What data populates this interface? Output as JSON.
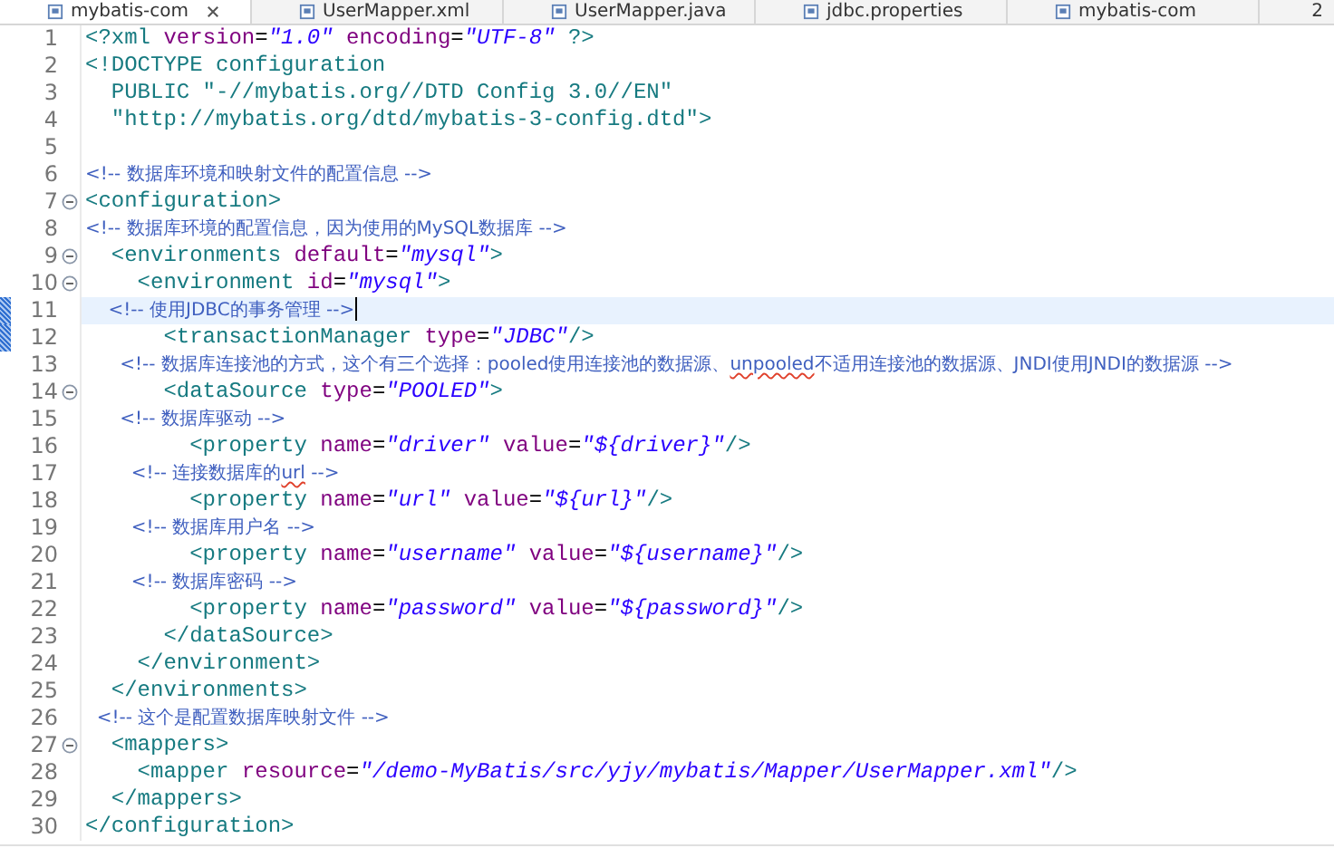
{
  "tabs": [
    {
      "label": "mybatis-com",
      "selected": true,
      "closable": true
    },
    {
      "label": "UserMapper.xml",
      "selected": false,
      "closable": false
    },
    {
      "label": "UserMapper.java",
      "selected": false,
      "closable": false
    },
    {
      "label": "jdbc.properties",
      "selected": false,
      "closable": false
    },
    {
      "label": "mybatis-com",
      "selected": false,
      "closable": false
    }
  ],
  "overflow_count": "2",
  "lines": [
    {
      "number": "1",
      "foldable": false,
      "current": false,
      "marked": false,
      "tokens": [
        {
          "kind": "tag",
          "text": "<?xml"
        },
        {
          "kind": "attr",
          "text": " version"
        },
        {
          "kind": "punct",
          "text": "="
        },
        {
          "kind": "value",
          "text": "\"1.0\""
        },
        {
          "kind": "attr",
          "text": " encoding"
        },
        {
          "kind": "punct",
          "text": "="
        },
        {
          "kind": "value",
          "text": "\"UTF-8\""
        },
        {
          "kind": "tag",
          "text": " ?>"
        }
      ]
    },
    {
      "number": "2",
      "foldable": false,
      "current": false,
      "marked": false,
      "tokens": [
        {
          "kind": "tag",
          "text": "<!DOCTYPE configuration"
        }
      ]
    },
    {
      "number": "3",
      "foldable": false,
      "current": false,
      "marked": false,
      "tokens": [
        {
          "kind": "tag",
          "text": "  PUBLIC \"-//mybatis.org//DTD Config 3.0//EN\""
        }
      ]
    },
    {
      "number": "4",
      "foldable": false,
      "current": false,
      "marked": false,
      "tokens": [
        {
          "kind": "tag",
          "text": "  \"http://mybatis.org/dtd/mybatis-3-config.dtd\">"
        }
      ]
    },
    {
      "number": "5",
      "foldable": false,
      "current": false,
      "marked": false
    },
    {
      "number": "6",
      "foldable": false,
      "current": false,
      "marked": false,
      "tokens": [
        {
          "kind": "comment",
          "text": "<!-- 数据库环境和映射文件的配置信息 -->"
        }
      ]
    },
    {
      "number": "7",
      "foldable": true,
      "current": false,
      "marked": false,
      "tokens": [
        {
          "kind": "tag",
          "text": "<configuration>"
        }
      ]
    },
    {
      "number": "8",
      "foldable": false,
      "current": false,
      "marked": false,
      "tokens": [
        {
          "kind": "comment",
          "text": "<!-- 数据库环境的配置信息，因为使用的MySQL数据库 -->"
        }
      ]
    },
    {
      "number": "9",
      "foldable": true,
      "current": false,
      "marked": false,
      "tokens": [
        {
          "kind": "tag",
          "text": "  <environments"
        },
        {
          "kind": "attr",
          "text": " default"
        },
        {
          "kind": "punct",
          "text": "="
        },
        {
          "kind": "value",
          "text": "\"mysql\""
        },
        {
          "kind": "tag",
          "text": ">"
        }
      ]
    },
    {
      "number": "10",
      "foldable": true,
      "current": false,
      "marked": false,
      "tokens": [
        {
          "kind": "tag",
          "text": "    <environment"
        },
        {
          "kind": "attr",
          "text": " id"
        },
        {
          "kind": "punct",
          "text": "="
        },
        {
          "kind": "value",
          "text": "\"mysql\""
        },
        {
          "kind": "tag",
          "text": ">"
        }
      ]
    },
    {
      "number": "11",
      "foldable": false,
      "current": true,
      "marked": true,
      "tokens": [
        {
          "kind": "comment",
          "text": "    <!-- 使用JDBC的事务管理 -->"
        }
      ]
    },
    {
      "number": "12",
      "foldable": false,
      "current": false,
      "marked": true,
      "tokens": [
        {
          "kind": "tag",
          "text": "      <transactionManager"
        },
        {
          "kind": "attr",
          "text": " type"
        },
        {
          "kind": "punct",
          "text": "="
        },
        {
          "kind": "value",
          "text": "\"JDBC\""
        },
        {
          "kind": "tag",
          "text": "/>"
        }
      ]
    },
    {
      "number": "13",
      "foldable": false,
      "current": false,
      "marked": false,
      "tokens": [
        {
          "kind": "comment",
          "text": "      <!-- 数据库连接池的方式，这个有三个选择：pooled使用连接池的数据源、"
        },
        {
          "kind": "misspelled",
          "text": "unpooled"
        },
        {
          "kind": "comment",
          "text": "不适用连接池的数据源、JNDI使用JNDI的数据源 -->"
        }
      ]
    },
    {
      "number": "14",
      "foldable": true,
      "current": false,
      "marked": false,
      "tokens": [
        {
          "kind": "tag",
          "text": "      <dataSource"
        },
        {
          "kind": "attr",
          "text": " type"
        },
        {
          "kind": "punct",
          "text": "="
        },
        {
          "kind": "value",
          "text": "\"POOLED\""
        },
        {
          "kind": "tag",
          "text": ">"
        }
      ]
    },
    {
      "number": "15",
      "foldable": false,
      "current": false,
      "marked": false,
      "tokens": [
        {
          "kind": "comment",
          "text": "      <!-- 数据库驱动 -->"
        }
      ]
    },
    {
      "number": "16",
      "foldable": false,
      "current": false,
      "marked": false,
      "tokens": [
        {
          "kind": "tag",
          "text": "        <property"
        },
        {
          "kind": "attr",
          "text": " name"
        },
        {
          "kind": "punct",
          "text": "="
        },
        {
          "kind": "value",
          "text": "\"driver\""
        },
        {
          "kind": "attr",
          "text": " value"
        },
        {
          "kind": "punct",
          "text": "="
        },
        {
          "kind": "value",
          "text": "\"${driver}\""
        },
        {
          "kind": "tag",
          "text": "/>"
        }
      ]
    },
    {
      "number": "17",
      "foldable": false,
      "current": false,
      "marked": false,
      "tokens": [
        {
          "kind": "comment",
          "text": "        <!-- 连接数据库的"
        },
        {
          "kind": "misspelled",
          "text": "url"
        },
        {
          "kind": "comment",
          "text": " -->"
        }
      ]
    },
    {
      "number": "18",
      "foldable": false,
      "current": false,
      "marked": false,
      "tokens": [
        {
          "kind": "tag",
          "text": "        <property"
        },
        {
          "kind": "attr",
          "text": " name"
        },
        {
          "kind": "punct",
          "text": "="
        },
        {
          "kind": "value",
          "text": "\"url\""
        },
        {
          "kind": "attr",
          "text": " value"
        },
        {
          "kind": "punct",
          "text": "="
        },
        {
          "kind": "value",
          "text": "\"${url}\""
        },
        {
          "kind": "tag",
          "text": "/>"
        }
      ]
    },
    {
      "number": "19",
      "foldable": false,
      "current": false,
      "marked": false,
      "tokens": [
        {
          "kind": "comment",
          "text": "        <!-- 数据库用户名 -->"
        }
      ]
    },
    {
      "number": "20",
      "foldable": false,
      "current": false,
      "marked": false,
      "tokens": [
        {
          "kind": "tag",
          "text": "        <property"
        },
        {
          "kind": "attr",
          "text": " name"
        },
        {
          "kind": "punct",
          "text": "="
        },
        {
          "kind": "value",
          "text": "\"username\""
        },
        {
          "kind": "attr",
          "text": " value"
        },
        {
          "kind": "punct",
          "text": "="
        },
        {
          "kind": "value",
          "text": "\"${username}\""
        },
        {
          "kind": "tag",
          "text": "/>"
        }
      ]
    },
    {
      "number": "21",
      "foldable": false,
      "current": false,
      "marked": false,
      "tokens": [
        {
          "kind": "comment",
          "text": "        <!-- 数据库密码 -->"
        }
      ]
    },
    {
      "number": "22",
      "foldable": false,
      "current": false,
      "marked": false,
      "tokens": [
        {
          "kind": "tag",
          "text": "        <property"
        },
        {
          "kind": "attr",
          "text": " name"
        },
        {
          "kind": "punct",
          "text": "="
        },
        {
          "kind": "value",
          "text": "\"password\""
        },
        {
          "kind": "attr",
          "text": " value"
        },
        {
          "kind": "punct",
          "text": "="
        },
        {
          "kind": "value",
          "text": "\"${password}\""
        },
        {
          "kind": "tag",
          "text": "/>"
        }
      ]
    },
    {
      "number": "23",
      "foldable": false,
      "current": false,
      "marked": false,
      "tokens": [
        {
          "kind": "tag",
          "text": "      </dataSource>"
        }
      ]
    },
    {
      "number": "24",
      "foldable": false,
      "current": false,
      "marked": false,
      "tokens": [
        {
          "kind": "tag",
          "text": "    </environment>"
        }
      ]
    },
    {
      "number": "25",
      "foldable": false,
      "current": false,
      "marked": false,
      "tokens": [
        {
          "kind": "tag",
          "text": "  </environments>"
        }
      ]
    },
    {
      "number": "26",
      "foldable": false,
      "current": false,
      "marked": false,
      "tokens": [
        {
          "kind": "comment",
          "text": "  <!-- 这个是配置数据库映射文件 -->"
        }
      ]
    },
    {
      "number": "27",
      "foldable": true,
      "current": false,
      "marked": false,
      "tokens": [
        {
          "kind": "tag",
          "text": "  <mappers>"
        }
      ]
    },
    {
      "number": "28",
      "foldable": false,
      "current": false,
      "marked": false,
      "tokens": [
        {
          "kind": "tag",
          "text": "    <mapper"
        },
        {
          "kind": "attr",
          "text": " resource"
        },
        {
          "kind": "punct",
          "text": "="
        },
        {
          "kind": "value",
          "text": "\"/demo-MyBatis/src/yjy/mybatis/Mapper/UserMapper.xml\""
        },
        {
          "kind": "tag",
          "text": "/>"
        }
      ]
    },
    {
      "number": "29",
      "foldable": false,
      "current": false,
      "marked": false,
      "tokens": [
        {
          "kind": "tag",
          "text": "  </mappers>"
        }
      ]
    },
    {
      "number": "30",
      "foldable": false,
      "current": false,
      "marked": false,
      "tokens": [
        {
          "kind": "tag",
          "text": "</configuration>"
        }
      ]
    }
  ]
}
